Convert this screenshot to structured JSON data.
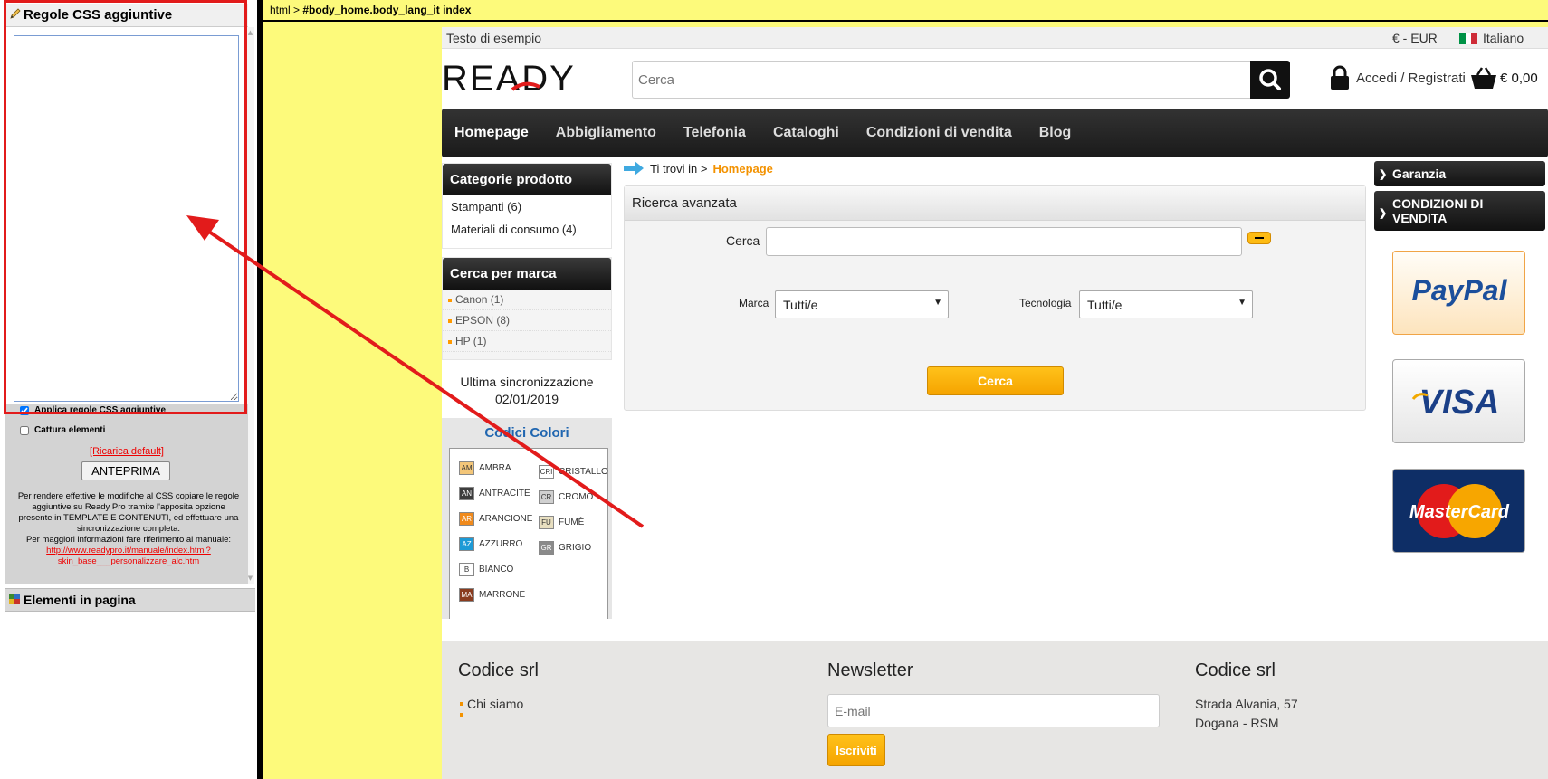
{
  "editor": {
    "css_panel_title": "Regole CSS aggiuntive",
    "css_value": "",
    "apply_label": "Applica regole CSS aggiuntive",
    "capture_label": "Cattura elementi",
    "reload_label": "[Ricarica default]",
    "preview_label": "ANTEPRIMA",
    "help_text": "Per rendere effettive le modifiche al CSS copiare le regole aggiuntive su Ready Pro tramite l'apposita opzione presente in TEMPLATE E CONTENUTI, ed effettuare una sincronizzazione completa.",
    "help_text_2": "Per maggiori informazioni fare riferimento al manuale:",
    "help_link": "http://www.readypro.it/manuale/index.html?skin_base___personalizzare_alc.htm",
    "elements_title": "Elementi in pagina"
  },
  "dom_path": {
    "root": "html",
    "separator": ">",
    "selected": "#body_home.body_lang_it index"
  },
  "site": {
    "topbar": {
      "sample_text": "Testo di esempio",
      "currency": "€ - EUR",
      "language": "Italiano"
    },
    "logo_text": "READY",
    "search_placeholder": "Cerca",
    "login_label": "Accedi / Registrati",
    "cart_total": "€ 0,00",
    "nav": [
      "Homepage",
      "Abbigliamento",
      "Telefonia",
      "Cataloghi",
      "Condizioni di vendita",
      "Blog"
    ],
    "categories": {
      "title": "Categorie prodotto",
      "items": [
        "Stampanti (6)",
        "Materiali di consumo (4)"
      ]
    },
    "brands": {
      "title": "Cerca per marca",
      "items": [
        "Canon (1)",
        "EPSON (8)",
        "HP (1)"
      ]
    },
    "sync": {
      "line1": "Ultima sincronizzazione",
      "line2": "02/01/2019"
    },
    "colors": {
      "title": "Codici Colori",
      "left": [
        {
          "code": "AM",
          "name": "AMBRA",
          "color": "#f3c679"
        },
        {
          "code": "AN",
          "name": "ANTRACITE",
          "color": "#3d3d3d"
        },
        {
          "code": "AR",
          "name": "ARANCIONE",
          "color": "#f08a1c"
        },
        {
          "code": "AZ",
          "name": "AZZURRO",
          "color": "#1d9ad6"
        },
        {
          "code": "B",
          "name": "BIANCO",
          "color": "#ffffff"
        },
        {
          "code": "MA",
          "name": "MARRONE",
          "color": "#8a3b1e"
        }
      ],
      "right": [
        {
          "code": "CRI",
          "name": "CRISTALLO",
          "color": "#ffffff"
        },
        {
          "code": "CR",
          "name": "CROMO",
          "color": "#d0d0d0"
        },
        {
          "code": "FU",
          "name": "FUMÈ",
          "color": "#e8dfc0"
        },
        {
          "code": "GR",
          "name": "GRIGIO",
          "color": "#8a8a8a"
        }
      ]
    },
    "breadcrumb": {
      "prefix": "Ti trovi in >",
      "current": "Homepage"
    },
    "advanced_search": {
      "title": "Ricerca avanzata",
      "search_label": "Cerca",
      "brand_label": "Marca",
      "brand_value": "Tutti/e",
      "tech_label": "Tecnologia",
      "tech_value": "Tutti/e",
      "button_label": "Cerca"
    },
    "side_links": [
      "Garanzia",
      "CONDIZIONI DI VENDITA"
    ],
    "payments": {
      "paypal": "PayPal",
      "visa": "VISA",
      "mastercard": "MasterCard"
    },
    "footer": {
      "col1_title": "Codice srl",
      "col1_link": "Chi siamo",
      "col2_title": "Newsletter",
      "email_placeholder": "E-mail",
      "subscribe_label": "Iscriviti",
      "col3_title": "Codice srl",
      "address1": "Strada Alvania, 57",
      "address2": "Dogana - RSM"
    }
  },
  "colors": {
    "annotation": "#e21b1b",
    "accent": "#f39200",
    "nav_bg": "#222222",
    "preview_bg": "#fdfa7b"
  }
}
